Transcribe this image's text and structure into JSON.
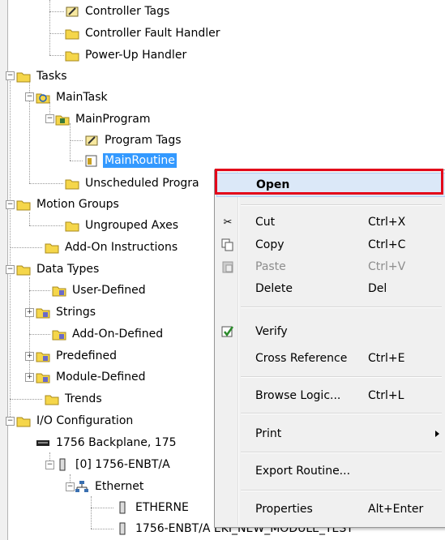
{
  "tree": {
    "controller_tags": "Controller Tags",
    "controller_fault_handler": "Controller Fault Handler",
    "power_up_handler": "Power-Up Handler",
    "tasks": "Tasks",
    "main_task": "MainTask",
    "main_program": "MainProgram",
    "program_tags": "Program Tags",
    "main_routine": "MainRoutine",
    "unscheduled_programs": "Unscheduled Progra",
    "motion_groups": "Motion Groups",
    "ungrouped_axes": "Ungrouped Axes",
    "add_on_instructions": "Add-On Instructions",
    "data_types": "Data Types",
    "user_defined": "User-Defined",
    "strings": "Strings",
    "add_on_defined": "Add-On-Defined",
    "predefined": "Predefined",
    "module_defined": "Module-Defined",
    "trends": "Trends",
    "io_configuration": "I/O Configuration",
    "backplane": "1756 Backplane, 175",
    "enbt_module": "[0] 1756-ENBT/A",
    "ethernet": "Ethernet",
    "ethernet_item": "ETHERNE",
    "enbt_new_module": "1756-ENBT/A EKI_NEW_MODULE_TEST"
  },
  "context_menu": {
    "open": "Open",
    "cut": "Cut",
    "cut_shortcut": "Ctrl+X",
    "copy": "Copy",
    "copy_shortcut": "Ctrl+C",
    "paste": "Paste",
    "paste_shortcut": "Ctrl+V",
    "delete": "Delete",
    "delete_shortcut": "Del",
    "verify": "Verify",
    "cross_reference": "Cross Reference",
    "cross_reference_shortcut": "Ctrl+E",
    "browse_logic": "Browse Logic...",
    "browse_logic_shortcut": "Ctrl+L",
    "print": "Print",
    "export_routine": "Export Routine...",
    "properties": "Properties",
    "properties_shortcut": "Alt+Enter"
  },
  "colors": {
    "selection": "#3399ff",
    "highlight_box": "#e3061a",
    "menu_background": "#f0f0f0",
    "folder": "#f5d64a"
  }
}
